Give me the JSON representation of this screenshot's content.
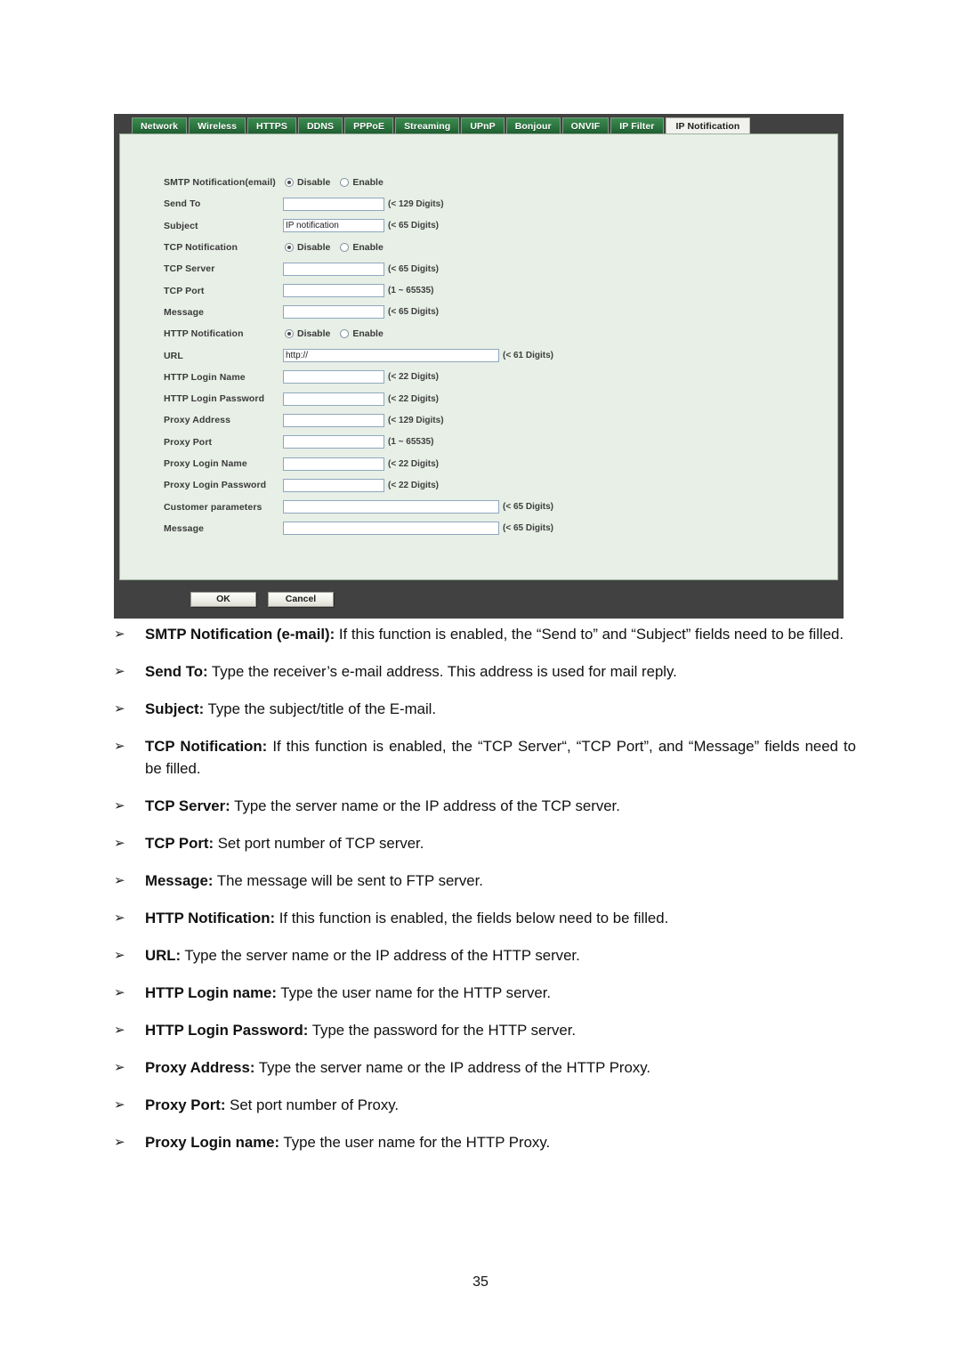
{
  "screenshot": {
    "tabs": [
      {
        "label": "Network",
        "active": false
      },
      {
        "label": "Wireless",
        "active": false
      },
      {
        "label": "HTTPS",
        "active": false
      },
      {
        "label": "DDNS",
        "active": false
      },
      {
        "label": "PPPoE",
        "active": false
      },
      {
        "label": "Streaming",
        "active": false
      },
      {
        "label": "UPnP",
        "active": false
      },
      {
        "label": "Bonjour",
        "active": false
      },
      {
        "label": "ONVIF",
        "active": false
      },
      {
        "label": "IP Filter",
        "active": false
      },
      {
        "label": "IP Notification",
        "active": true
      }
    ],
    "rows": [
      {
        "label": "SMTP Notification(email)",
        "type": "radio",
        "selected": "Disable",
        "options": [
          "Disable",
          "Enable"
        ]
      },
      {
        "label": "Send To",
        "type": "text",
        "value": "",
        "hint": "(< 129 Digits)",
        "width": "narrow"
      },
      {
        "label": "Subject",
        "type": "text",
        "value": "IP notification",
        "hint": "(< 65 Digits)",
        "width": "narrow"
      },
      {
        "label": "TCP Notification",
        "type": "radio",
        "selected": "Disable",
        "options": [
          "Disable",
          "Enable"
        ]
      },
      {
        "label": "TCP Server",
        "type": "text",
        "value": "",
        "hint": "(< 65 Digits)",
        "width": "narrow"
      },
      {
        "label": "TCP Port",
        "type": "text",
        "value": "",
        "hint": "(1 ~ 65535)",
        "width": "narrow"
      },
      {
        "label": "Message",
        "type": "text",
        "value": "",
        "hint": "(< 65 Digits)",
        "width": "narrow"
      },
      {
        "label": "HTTP Notification",
        "type": "radio",
        "selected": "Disable",
        "options": [
          "Disable",
          "Enable"
        ]
      },
      {
        "label": "URL",
        "type": "text",
        "value": "http://",
        "hint": "(< 61 Digits)",
        "width": "wide"
      },
      {
        "label": "HTTP Login Name",
        "type": "text",
        "value": "",
        "hint": "(< 22 Digits)",
        "width": "narrow"
      },
      {
        "label": "HTTP Login Password",
        "type": "text",
        "value": "",
        "hint": "(< 22 Digits)",
        "width": "narrow"
      },
      {
        "label": "Proxy Address",
        "type": "text",
        "value": "",
        "hint": "(< 129 Digits)",
        "width": "narrow"
      },
      {
        "label": "Proxy Port",
        "type": "text",
        "value": "",
        "hint": "(1 ~ 65535)",
        "width": "narrow"
      },
      {
        "label": "Proxy Login Name",
        "type": "text",
        "value": "",
        "hint": "(< 22 Digits)",
        "width": "narrow"
      },
      {
        "label": "Proxy Login Password",
        "type": "text",
        "value": "",
        "hint": "(< 22 Digits)",
        "width": "narrow"
      },
      {
        "label": "Customer parameters",
        "type": "text",
        "value": "",
        "hint": "(< 65 Digits)",
        "width": "wide"
      },
      {
        "label": "Message",
        "type": "text",
        "value": "",
        "hint": "(< 65 Digits)",
        "width": "wide"
      }
    ],
    "buttons": {
      "ok": "OK",
      "cancel": "Cancel"
    },
    "colors": {
      "tab_green": "#2f7a43",
      "panel_bg": "#e7efe6",
      "frame": "#414141",
      "field_border": "#8fa7bf"
    }
  },
  "document": {
    "bullet_glyph": "➢",
    "bullets": [
      {
        "term": "SMTP Notification (e-mail):",
        "text": " If this function is enabled, the “Send to” and “Subject” fields need to be filled."
      },
      {
        "term": "Send To:",
        "text": " Type the receiver’s e-mail address. This address is used for mail reply."
      },
      {
        "term": "Subject:",
        "text": " Type the subject/title of the E-mail."
      },
      {
        "term": "TCP Notification:",
        "text": " If this function is enabled, the “TCP Server“, “TCP Port”, and “Message” fields need to be filled."
      },
      {
        "term": "TCP Server:",
        "text": " Type the server name or the IP address of the TCP server."
      },
      {
        "term": "TCP Port:",
        "text": " Set port number of TCP server."
      },
      {
        "term": "Message:",
        "text": " The message will be sent to FTP server."
      },
      {
        "term": "HTTP Notification:",
        "text": " If this function is enabled, the fields below need to be filled."
      },
      {
        "term": "URL:",
        "text": " Type the server name or the IP address of the HTTP server."
      },
      {
        "term": "HTTP Login name:",
        "text": " Type the user name for the HTTP server."
      },
      {
        "term": "HTTP Login Password:",
        "text": " Type the password for the HTTP server."
      },
      {
        "term": "Proxy Address:",
        "text": " Type the server name or the IP address of the HTTP Proxy."
      },
      {
        "term": "Proxy Port:",
        "text": " Set port number of Proxy."
      },
      {
        "term": "Proxy Login name:",
        "text": " Type the user name for the HTTP Proxy."
      }
    ],
    "page_number": "35"
  }
}
